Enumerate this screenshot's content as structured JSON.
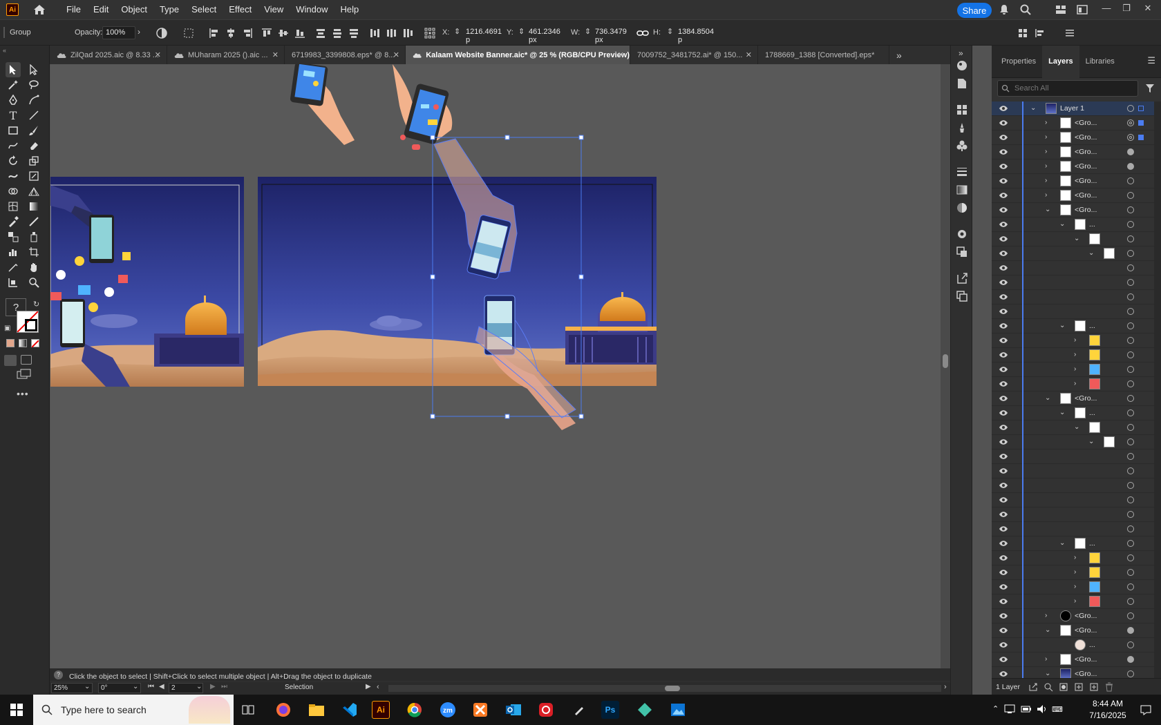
{
  "app": {
    "logo_text": "Ai"
  },
  "menu": [
    "File",
    "Edit",
    "Object",
    "Type",
    "Select",
    "Effect",
    "View",
    "Window",
    "Help"
  ],
  "titlebar": {
    "share_label": "Share"
  },
  "control_bar": {
    "selection_type": "Group",
    "opacity_label": "Opacity:",
    "opacity_value": "100%",
    "x_label": "X:",
    "x_value": "1216.4691 p",
    "y_label": "Y:",
    "y_value": "461.2346 px",
    "w_label": "W:",
    "w_value": "736.3479 px",
    "h_label": "H:",
    "h_value": "1384.8504 p"
  },
  "tabs": [
    {
      "label": "ZilQad 2025.aic @ 8.33 ...",
      "cloud": true,
      "active": false
    },
    {
      "label": "MUharam 2025 ().aic ...",
      "cloud": true,
      "active": false
    },
    {
      "label": "6719983_3399808.eps* @ 8...",
      "cloud": false,
      "active": false
    },
    {
      "label": "Kalaam Website Banner.aic* @ 25 % (RGB/CPU Preview)",
      "cloud": true,
      "active": true
    },
    {
      "label": "7009752_3481752.ai* @ 150...",
      "cloud": false,
      "active": false
    },
    {
      "label": "1788669_1388 [Converted].eps*",
      "cloud": false,
      "active": false
    }
  ],
  "panel": {
    "tabs": [
      "Properties",
      "Layers",
      "Libraries"
    ],
    "active_tab": "Layers",
    "search_placeholder": "Search All",
    "footer_label": "1 Layer",
    "layers": [
      {
        "name": "Layer 1",
        "indent": 0,
        "chev": "down",
        "sel": true,
        "thumb": "banner",
        "target": "ring",
        "sq": true
      },
      {
        "name": "<Gro...",
        "indent": 1,
        "chev": "right",
        "thumb": "hand",
        "target": "dbl",
        "sq": true
      },
      {
        "name": "<Gro...",
        "indent": 1,
        "chev": "right",
        "thumb": "hand",
        "target": "dbl",
        "sq": true
      },
      {
        "name": "<Gro...",
        "indent": 1,
        "chev": "right",
        "thumb": "dot",
        "target": "fill"
      },
      {
        "name": "<Gro...",
        "indent": 1,
        "chev": "right",
        "thumb": "dot",
        "target": "fill"
      },
      {
        "name": "<Gro...",
        "indent": 1,
        "chev": "right",
        "thumb": "phone",
        "target": "ring"
      },
      {
        "name": "<Gro...",
        "indent": 1,
        "chev": "right",
        "thumb": "phone",
        "target": "ring"
      },
      {
        "name": "<Gro...",
        "indent": 1,
        "chev": "down",
        "thumb": "hand",
        "target": "ring"
      },
      {
        "name": "...",
        "indent": 2,
        "chev": "down",
        "thumb": "hand",
        "target": "ring"
      },
      {
        "name": "",
        "indent": 3,
        "chev": "down",
        "thumb": "hand",
        "target": "ring"
      },
      {
        "name": "",
        "indent": 4,
        "chev": "down",
        "thumb": "hand",
        "target": "ring"
      },
      {
        "name": "",
        "indent": 5,
        "chev": "",
        "thumb": "",
        "target": "ring"
      },
      {
        "name": "",
        "indent": 5,
        "chev": "",
        "thumb": "",
        "target": "ring"
      },
      {
        "name": "",
        "indent": 5,
        "chev": "",
        "thumb": "",
        "target": "ring"
      },
      {
        "name": "",
        "indent": 5,
        "chev": "",
        "thumb": "",
        "target": "ring"
      },
      {
        "name": "...",
        "indent": 2,
        "chev": "down",
        "thumb": "icons",
        "target": "ring"
      },
      {
        "name": "",
        "indent": 3,
        "chev": "right",
        "thumb": "yellow",
        "target": "ring"
      },
      {
        "name": "",
        "indent": 3,
        "chev": "right",
        "thumb": "yellow",
        "target": "ring"
      },
      {
        "name": "",
        "indent": 3,
        "chev": "right",
        "thumb": "blue",
        "target": "ring"
      },
      {
        "name": "",
        "indent": 3,
        "chev": "right",
        "thumb": "red",
        "target": "ring"
      },
      {
        "name": "<Gro...",
        "indent": 1,
        "chev": "down",
        "thumb": "hand",
        "target": "ring"
      },
      {
        "name": "...",
        "indent": 2,
        "chev": "down",
        "thumb": "hand",
        "target": "ring"
      },
      {
        "name": "",
        "indent": 3,
        "chev": "down",
        "thumb": "hand",
        "target": "ring"
      },
      {
        "name": "",
        "indent": 4,
        "chev": "down",
        "thumb": "hand",
        "target": "ring"
      },
      {
        "name": "",
        "indent": 5,
        "chev": "",
        "thumb": "",
        "target": "ring"
      },
      {
        "name": "",
        "indent": 5,
        "chev": "",
        "thumb": "",
        "target": "ring"
      },
      {
        "name": "",
        "indent": 5,
        "chev": "",
        "thumb": "",
        "target": "ring"
      },
      {
        "name": "",
        "indent": 5,
        "chev": "",
        "thumb": "",
        "target": "ring"
      },
      {
        "name": "",
        "indent": 5,
        "chev": "",
        "thumb": "",
        "target": "ring"
      },
      {
        "name": "",
        "indent": 5,
        "chev": "",
        "thumb": "",
        "target": "ring"
      },
      {
        "name": "...",
        "indent": 2,
        "chev": "down",
        "thumb": "icons",
        "target": "ring"
      },
      {
        "name": "",
        "indent": 3,
        "chev": "right",
        "thumb": "yellow",
        "target": "ring"
      },
      {
        "name": "",
        "indent": 3,
        "chev": "right",
        "thumb": "yellow",
        "target": "ring"
      },
      {
        "name": "",
        "indent": 3,
        "chev": "right",
        "thumb": "blue",
        "target": "ring"
      },
      {
        "name": "",
        "indent": 3,
        "chev": "right",
        "thumb": "red",
        "target": "ring"
      },
      {
        "name": "<Gro...",
        "indent": 1,
        "chev": "right",
        "thumb": "black",
        "target": "ring"
      },
      {
        "name": "<Gro...",
        "indent": 1,
        "chev": "down",
        "thumb": "white",
        "target": "fill"
      },
      {
        "name": "...",
        "indent": 2,
        "chev": "",
        "thumb": "circle",
        "target": "ring"
      },
      {
        "name": "<Gro...",
        "indent": 1,
        "chev": "right",
        "thumb": "white",
        "target": "fill"
      },
      {
        "name": "<Gro...",
        "indent": 1,
        "chev": "down",
        "thumb": "banner",
        "target": "ring"
      }
    ]
  },
  "status": {
    "hint": "Click the object to select  |  Shift+Click to select multiple object  |  Alt+Drag the object to duplicate",
    "zoom": "25%",
    "rotation": "0°",
    "artboard": "2",
    "tool_name": "Selection"
  },
  "taskbar": {
    "search_placeholder": "Type here to search",
    "time": "8:44 AM",
    "date": "7/16/2025",
    "apps": [
      "Firefox",
      "File Explorer",
      "VS Code",
      "Illustrator",
      "Chrome",
      "Zoom",
      "XAMPP",
      "Outlook",
      "Creative Cloud",
      "Pen",
      "Photoshop",
      "App",
      "Photos"
    ]
  },
  "colors": {
    "accent": "#1473e6",
    "selection": "#4b7cf0",
    "sky_top": "#1d2266",
    "sky_bottom": "#5266c6",
    "sand": "#c99466"
  }
}
